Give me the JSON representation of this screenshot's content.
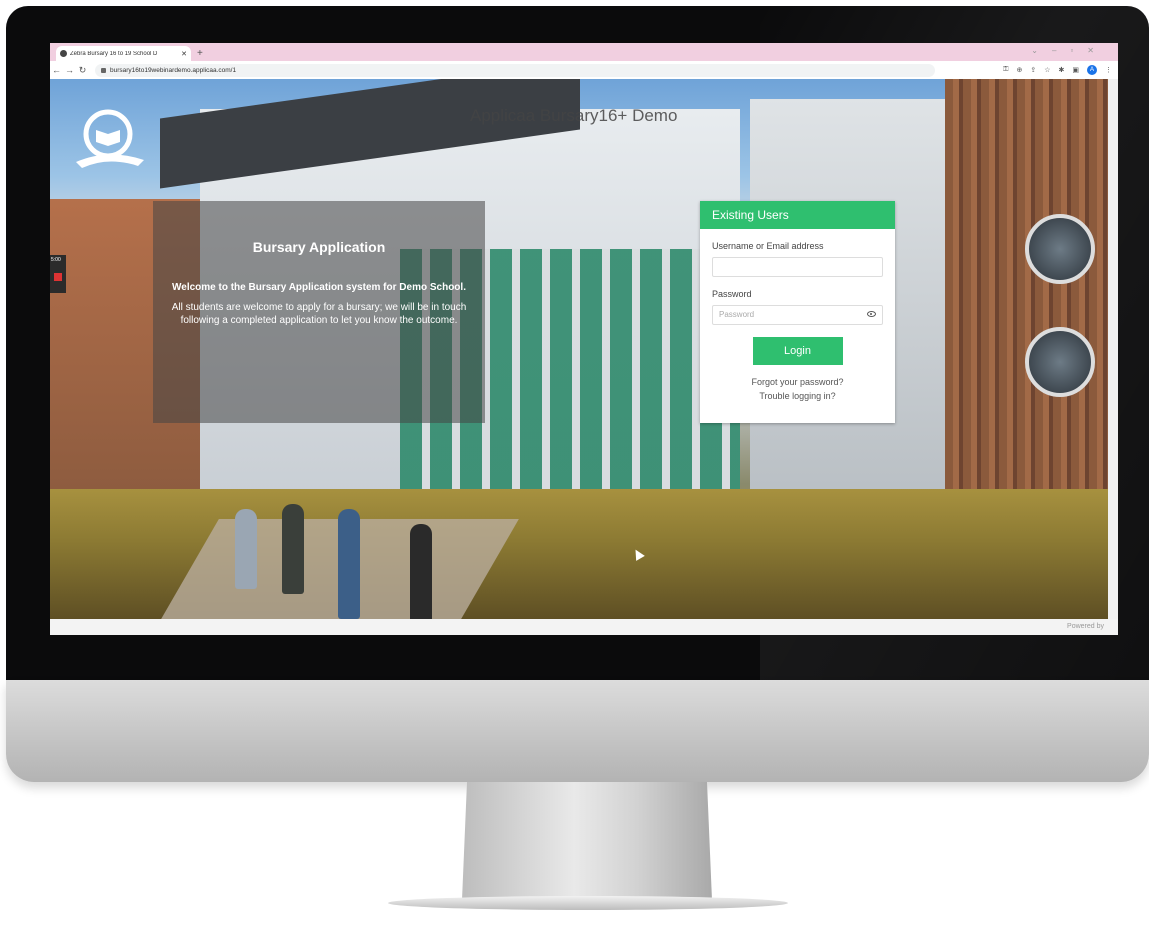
{
  "browser": {
    "tab_title": "Zebra Bursary 16 to 19 School D",
    "new_tab_icon": "+",
    "url": "bursary16to19webinardemo.applicaa.com/1",
    "profile_initial": "A",
    "icons": [
      "back-arrow-icon",
      "forward-arrow-icon",
      "reload-icon",
      "lock-icon",
      "key-icon",
      "zoom-icon",
      "share-icon",
      "star-icon",
      "extensions-icon",
      "sidepanel-icon",
      "menu-icon"
    ]
  },
  "page": {
    "site_title": "Applicaa Bursary16+ Demo",
    "logo_icon": "book-emblem-icon",
    "side_widget": {
      "time": "5:00"
    },
    "info": {
      "heading": "Bursary Application",
      "welcome": "Welcome to the Bursary Application system for Demo School.",
      "body": "All students are welcome to apply for a bursary; we will be in touch following a completed application to let you know the outcome."
    },
    "login": {
      "header": "Existing Users",
      "username_label": "Username or Email address",
      "username_value": "",
      "password_label": "Password",
      "password_placeholder": "Password",
      "button": "Login",
      "forgot_link": "Forgot your password?",
      "trouble_link": "Trouble logging in?",
      "accent_color": "#2fbf6f"
    },
    "footer": {
      "powered_by": "Powered by"
    }
  }
}
